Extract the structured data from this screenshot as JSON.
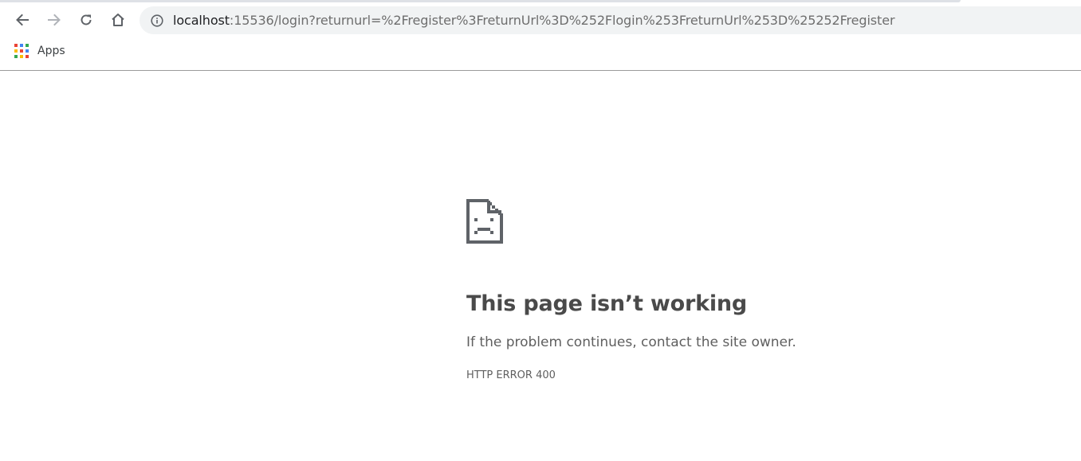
{
  "browser": {
    "url_host": "localhost",
    "url_rest": ":15536/login?returnurl=%2Fregister%3FreturnUrl%3D%252Flogin%253FreturnUrl%253D%25252Fregister",
    "nav_icons": [
      "back-arrow-icon",
      "forward-arrow-icon",
      "reload-icon",
      "home-icon"
    ],
    "info_icon": "info-icon"
  },
  "bookmarks": {
    "apps_label": "Apps",
    "apps_icon": "apps-grid-icon",
    "apps_colors": [
      "#ea4335",
      "#4285f4",
      "#34a853",
      "#fbbc05"
    ]
  },
  "error": {
    "icon": "sad-page-icon",
    "title": "This page isn’t working",
    "description": "If the problem continues, contact the site owner.",
    "code": "HTTP ERROR 400"
  }
}
